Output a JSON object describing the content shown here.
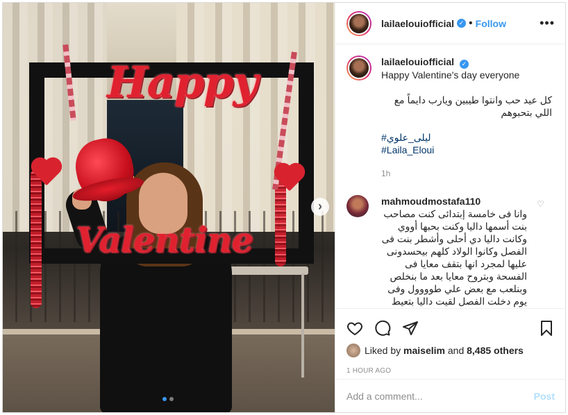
{
  "post": {
    "username": "lailaelouiofficial",
    "separator": "•",
    "follow_label": "Follow",
    "more_label": "•••"
  },
  "media": {
    "sign_happy": "Happy",
    "sign_valentine": "Valentine",
    "next_label": "›"
  },
  "caption": {
    "username": "lailaelouiofficial",
    "line1": "Happy Valentine's day everyone",
    "line2": "كل عيد حب وانتوا طيبين ويارب دايماً مع اللي بتحبوهم",
    "hashtag1": "#ليلى_علوي",
    "hashtag2": "#Laila_Eloui",
    "time": "1h"
  },
  "comment": {
    "username": "mahmoudmostafa110",
    "text": "وانا فى خامسة إبتدائى كنت مصاحب بنت أسمها داليا وكنت بحبها أووي وكانت داليا دي أحلى وأشطر بنت فى الفصل وكانوا الولاد كلهم بيحسدونى عليها لمجرد انها بتقف معايا فى الفسحة وبتروح معايا بعد ما بنخلص وبنلعب مع بعض علي طوووول وفى يوم دخلت الفصل لقيت داليا بتعيط فسئلتها بتعيطى ليه ؟؟ قالتلى نسيت كتاب"
  },
  "likes": {
    "prefix": "Liked by",
    "user": "maiselim",
    "middle": "and",
    "count": "8,485 others"
  },
  "post_time": "1 HOUR AGO",
  "add_comment": {
    "placeholder": "Add a comment...",
    "post_label": "Post"
  },
  "colors": {
    "accent": "#3897f0",
    "hashtag": "#003569",
    "muted": "#8e8e8e",
    "post_disabled": "#b2dffc"
  },
  "icons": [
    "verified-badge-icon",
    "more-options-icon",
    "heart-icon",
    "comment-icon",
    "share-icon",
    "bookmark-icon",
    "next-arrow-icon"
  ],
  "carousel": {
    "total": 2,
    "active_index": 0
  }
}
